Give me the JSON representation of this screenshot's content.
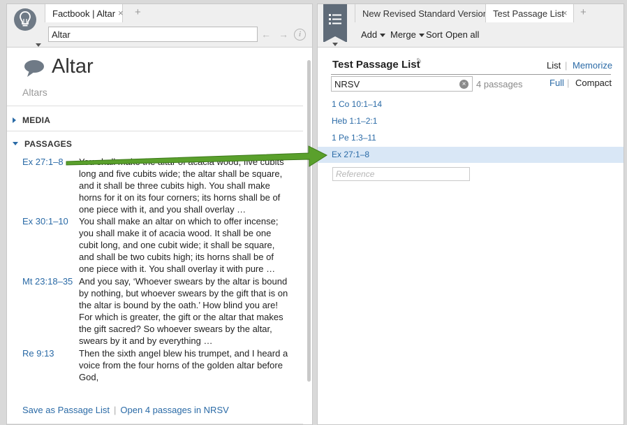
{
  "left": {
    "tab_title": "Factbook | Altar",
    "tab_close": "×",
    "tab_add": "+",
    "search_value": "Altar",
    "back_arrow": "←",
    "forward_arrow": "→",
    "info": "i",
    "article_title": "Altar",
    "article_subtitle": "Altars",
    "sections": {
      "media": "MEDIA",
      "passages": "PASSAGES"
    },
    "passages": [
      {
        "ref": "Ex 27:1–8",
        "lines": [
          "You shall make the altar of acacia wood, five cubits",
          "long and five cubits wide; the altar shall be square,",
          "and it shall be three cubits high. You shall make",
          "horns for it on its four corners; its horns shall be of",
          "one piece with it, and you shall overlay …"
        ]
      },
      {
        "ref": "Ex 30:1–10",
        "lines": [
          "You shall make an altar on which to offer incense;",
          "you shall make it of acacia wood. It shall be one",
          "cubit long, and one cubit wide; it shall be square,",
          "and shall be two cubits high; its horns shall be of",
          "one piece with it. You shall overlay it with pure …"
        ]
      },
      {
        "ref": "Mt 23:18–35",
        "lines": [
          "And you say, ‘Whoever swears by the altar is bound",
          "by nothing, but whoever swears by the gift that is on",
          "the altar is bound by the oath.’ How blind you are!",
          "For which is greater, the gift or the altar that makes",
          "the gift sacred? So whoever swears by the altar,",
          "swears by it and by everything …"
        ]
      },
      {
        "ref": "Re 9:13",
        "lines": [
          "Then the sixth angel blew his trumpet, and I heard a",
          "voice from the four horns of the golden altar before",
          "God,"
        ]
      }
    ],
    "footer": {
      "save": "Save as Passage List",
      "sep": "|",
      "open": "Open 4 passages in NRSV"
    }
  },
  "right": {
    "tabs": [
      "New Revised Standard Version",
      "Test Passage List"
    ],
    "tab_close": "×",
    "tab_add": "+",
    "toolbar": {
      "add": "Add",
      "merge": "Merge",
      "sort": "Sort",
      "open_all": "Open all"
    },
    "list_title": "Test Passage List",
    "edit_glyph": "✎",
    "view": {
      "list": "List",
      "memorize": "Memorize",
      "full": "Full",
      "compact": "Compact",
      "sep": "|"
    },
    "version_value": "NRSV",
    "clear": "×",
    "count": "4 passages",
    "refs": [
      "1 Co 10:1–14",
      "Heb 1:1–2:1",
      "1 Pe 1:3–11",
      "Ex 27:1–8"
    ],
    "reference_placeholder": "Reference"
  },
  "colors": {
    "link": "#2a6aa6",
    "selected_row": "#d9e7f6",
    "arrow": "#5aa02c",
    "icon_gray": "#6f7a86"
  }
}
